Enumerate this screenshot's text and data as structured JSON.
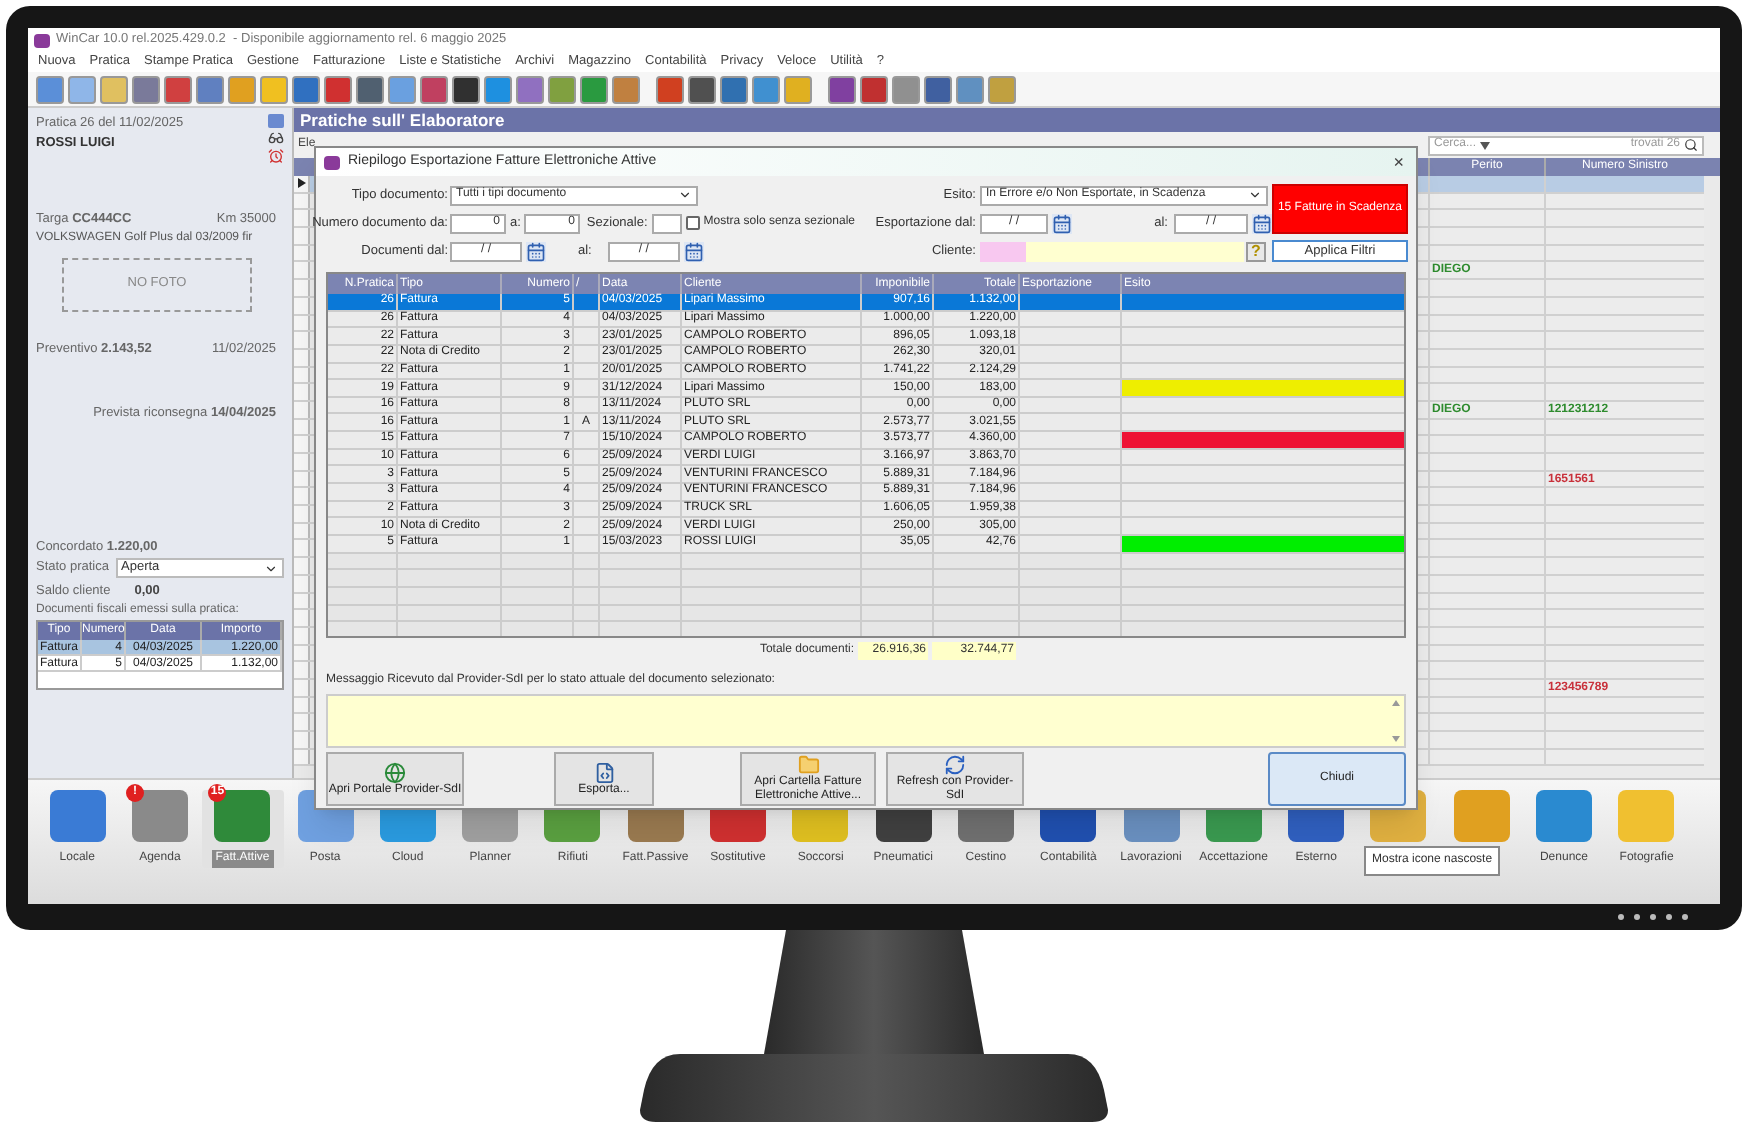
{
  "window": {
    "title": "WinCar 10.0 rel.2025.429.0.2  - Disponibile aggiornamento rel. 6 maggio 2025"
  },
  "menu": [
    "Nuova",
    "Pratica",
    "Stampe Pratica",
    "Gestione",
    "Fatturazione",
    "Liste e Statistiche",
    "Archivi",
    "Magazzino",
    "Contabilità",
    "Privacy",
    "Veloce",
    "Utilità",
    "?"
  ],
  "practice": {
    "header": "Pratica 26 del 11/02/2025",
    "customer": "ROSSI LUIGI",
    "plate": "Targa **CC444CC**",
    "km": "Km 35000",
    "vehicle": "VOLKSWAGEN Golf Plus dal 03/2009 fir",
    "photo": "NO FOTO",
    "estimate": "Preventivo **2.143,52**",
    "estimate_date": "11/02/2025",
    "return": "Prevista riconsegna **14/04/2025**",
    "agreed": "Concordato **1.220,00**",
    "status_label": "Stato pratica",
    "status": "Aperta",
    "balance_label": "Saldo cliente",
    "balance": "0,00",
    "docs_title": "Documenti fiscali emessi sulla pratica:",
    "docs_columns": [
      "Tipo",
      "Numero",
      "Data",
      "Importo"
    ],
    "docs": [
      {
        "cells": [
          "Fattura",
          "4",
          "04/03/2025",
          "1.220,00"
        ],
        "selected": true
      },
      {
        "cells": [
          "Fattura",
          "5",
          "04/03/2025",
          "1.132,00"
        ],
        "selected": false
      }
    ]
  },
  "main": {
    "title": "Pratiche sull' Elaboratore",
    "column_1": "Ele",
    "search": {
      "placeholder": "Cerca...",
      "count": "trovati 26"
    },
    "columns": [
      "Perito",
      "Numero Sinistro"
    ],
    "rows": [
      {
        "selected": true
      },
      {
        "selected": false
      },
      {
        "selected": false
      },
      {
        "selected": false
      },
      {
        "selected": false
      },
      {
        "selected": false,
        "perito": "DIEGO",
        "color": "#2e8b2e"
      },
      {
        "selected": false
      },
      {
        "selected": false
      },
      {
        "selected": false
      },
      {
        "selected": false
      },
      {
        "selected": false
      },
      {
        "selected": false
      },
      {
        "selected": false
      },
      {
        "selected": false,
        "perito": "DIEGO",
        "sinistro": "121231212",
        "color": "#2e8b2e"
      },
      {
        "selected": false
      },
      {
        "selected": false
      },
      {
        "selected": false
      },
      {
        "selected": false,
        "sinistro": "1651561",
        "color": "#c8303a"
      },
      {
        "selected": false
      },
      {
        "selected": false
      },
      {
        "selected": false
      },
      {
        "selected": false
      },
      {
        "selected": false
      },
      {
        "selected": false
      },
      {
        "selected": false
      },
      {
        "selected": false
      },
      {
        "selected": false
      },
      {
        "selected": false
      },
      {
        "selected": false
      },
      {
        "selected": false,
        "sinistro": "123456789",
        "color": "#c8303a"
      },
      {
        "selected": false
      },
      {
        "selected": false
      },
      {
        "selected": false
      },
      {
        "selected": false
      }
    ]
  },
  "dialog": {
    "title": "Riepilogo Esportazione Fatture Elettroniche Attive",
    "close": "×",
    "filters": {
      "doc_type": {
        "label": "Tipo documento:",
        "value": "Tutti i tipi documento"
      },
      "number_from": {
        "label": "Numero documento da:",
        "value": "0"
      },
      "number_to": {
        "label": "a:",
        "value": "0"
      },
      "sectional": {
        "label": "Sezionale:"
      },
      "only_no_sectional": {
        "label": "Mostra solo senza sezionale",
        "checked": false
      },
      "docs_from": {
        "label": "Documenti dal:",
        "value": "/ /"
      },
      "docs_to": {
        "label": "al:",
        "value": "/ /"
      },
      "outcome": {
        "label": "Esito:",
        "value": "In Errore e/o Non Esportate, in Scadenza"
      },
      "export_from": {
        "label": "Esportazione dal:",
        "value": "/ /"
      },
      "export_to": {
        "label": "al:",
        "value": "/ /"
      },
      "customer": {
        "label": "Cliente:"
      },
      "help": "?",
      "due_badge": "15 Fatture in Scadenza",
      "apply": "Applica Filtri"
    },
    "columns": [
      "N.Pratica",
      "Tipo",
      "Numero",
      "/",
      "Data",
      "Cliente",
      "Imponibile",
      "Totale",
      "Esportazione",
      "Esito"
    ],
    "rows": [
      {
        "pratica": "26",
        "tipo": "Fattura",
        "numero": "5",
        "data": "04/03/2025",
        "cliente": "Lipari Massimo",
        "imponibile": "907,16",
        "totale": "1.132,00",
        "selected": true
      },
      {
        "pratica": "26",
        "tipo": "Fattura",
        "numero": "4",
        "data": "04/03/2025",
        "cliente": "Lipari Massimo",
        "imponibile": "1.000,00",
        "totale": "1.220,00",
        "selected": false
      },
      {
        "pratica": "22",
        "tipo": "Fattura",
        "numero": "3",
        "data": "23/01/2025",
        "cliente": "CAMPOLO ROBERTO",
        "imponibile": "896,05",
        "totale": "1.093,18",
        "selected": false
      },
      {
        "pratica": "22",
        "tipo": "Nota di Credito",
        "numero": "2",
        "data": "23/01/2025",
        "cliente": "CAMPOLO ROBERTO",
        "imponibile": "262,30",
        "totale": "320,01",
        "selected": false
      },
      {
        "pratica": "22",
        "tipo": "Fattura",
        "numero": "1",
        "data": "20/01/2025",
        "cliente": "CAMPOLO ROBERTO",
        "imponibile": "1.741,22",
        "totale": "2.124,29",
        "selected": false
      },
      {
        "pratica": "19",
        "tipo": "Fattura",
        "numero": "9",
        "data": "31/12/2024",
        "cliente": "Lipari Massimo",
        "imponibile": "150,00",
        "totale": "183,00",
        "selected": false,
        "color": "#eeee00"
      },
      {
        "pratica": "16",
        "tipo": "Fattura",
        "numero": "8",
        "data": "13/11/2024",
        "cliente": "PLUTO SRL",
        "imponibile": "0,00",
        "totale": "0,00",
        "selected": false
      },
      {
        "pratica": "16",
        "tipo": "Fattura",
        "numero": "1",
        "suffix": "A",
        "data": "13/11/2024",
        "cliente": "PLUTO SRL",
        "imponibile": "2.573,77",
        "totale": "3.021,55",
        "selected": false
      },
      {
        "pratica": "15",
        "tipo": "Fattura",
        "numero": "7",
        "data": "15/10/2024",
        "cliente": "CAMPOLO ROBERTO",
        "imponibile": "3.573,77",
        "totale": "4.360,00",
        "selected": false,
        "color": "#ee1133"
      },
      {
        "pratica": "10",
        "tipo": "Fattura",
        "numero": "6",
        "data": "25/09/2024",
        "cliente": "VERDI LUIGI",
        "imponibile": "3.166,97",
        "totale": "3.863,70",
        "selected": false
      },
      {
        "pratica": "3",
        "tipo": "Fattura",
        "numero": "5",
        "data": "25/09/2024",
        "cliente": "VENTURINI FRANCESCO",
        "imponibile": "5.889,31",
        "totale": "7.184,96",
        "selected": false
      },
      {
        "pratica": "3",
        "tipo": "Fattura",
        "numero": "4",
        "data": "25/09/2024",
        "cliente": "VENTURINI FRANCESCO",
        "imponibile": "5.889,31",
        "totale": "7.184,96",
        "selected": false
      },
      {
        "pratica": "2",
        "tipo": "Fattura",
        "numero": "3",
        "data": "25/09/2024",
        "cliente": "TRUCK SRL",
        "imponibile": "1.606,05",
        "totale": "1.959,38",
        "selected": false
      },
      {
        "pratica": "10",
        "tipo": "Nota di Credito",
        "numero": "2",
        "data": "25/09/2024",
        "cliente": "VERDI LUIGI",
        "imponibile": "250,00",
        "totale": "305,00",
        "selected": false
      },
      {
        "pratica": "5",
        "tipo": "Fattura",
        "numero": "1",
        "data": "15/03/2023",
        "cliente": "ROSSI LUIGI",
        "imponibile": "35,05",
        "totale": "42,76",
        "selected": false,
        "color": "#00ee00"
      }
    ],
    "totals": {
      "label": "Totale documenti:",
      "taxable": "26.916,36",
      "total": "32.744,77"
    },
    "message": {
      "label": "Messaggio Ricevuto dal Provider-SdI per lo stato attuale del documento selezionato:"
    },
    "buttons": [
      {
        "kind": "globe",
        "label": "Apri Portale Provider-SdI"
      },
      {
        "kind": "xml",
        "label": "Esporta..."
      },
      {
        "kind": "folder",
        "label": "Apri Cartella Fatture Elettroniche Attive..."
      },
      {
        "kind": "refresh",
        "label": "Refresh con Provider-SdI"
      },
      {
        "kind": "close",
        "label": "Chiudi"
      }
    ]
  },
  "dock": {
    "tooltip": "Mostra icone nascoste",
    "items": [
      {
        "label": "Locale",
        "selected": false
      },
      {
        "label": "Agenda",
        "badge": "!",
        "selected": false
      },
      {
        "label": "Fatt.Attive",
        "badge": "15",
        "selected": true
      },
      {
        "label": "Posta",
        "selected": false
      },
      {
        "label": "Cloud",
        "selected": false
      },
      {
        "label": "Planner",
        "selected": false
      },
      {
        "label": "Rifiuti",
        "selected": false
      },
      {
        "label": "Fatt.Passive",
        "selected": false
      },
      {
        "label": "Sostitutive",
        "selected": false
      },
      {
        "label": "Soccorsi",
        "selected": false
      },
      {
        "label": "Pneumatici",
        "selected": false
      },
      {
        "label": "Cestino",
        "selected": false
      },
      {
        "label": "Contabilità",
        "selected": false
      },
      {
        "label": "Lavorazioni",
        "selected": false
      },
      {
        "label": "Accettazione",
        "selected": false
      },
      {
        "label": "Esterno",
        "selected": false
      },
      {
        "selected": false
      },
      {
        "selected": false
      },
      {
        "label": "Denunce",
        "selected": false
      },
      {
        "label": "Fotografie",
        "selected": false
      }
    ]
  }
}
